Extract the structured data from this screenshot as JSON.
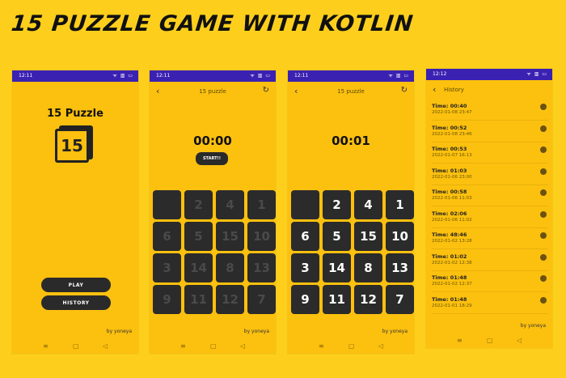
{
  "banner": "15 PUZZLE GAME WITH KOTLIN",
  "screens": {
    "home": {
      "status_time": "12:11",
      "status_icons": "ᯤ ▥ ▭",
      "app_title": "15 Puzzle",
      "logo_text": "15",
      "play": "PLAY",
      "history": "HISTORY",
      "author": "by yoneya"
    },
    "game_start": {
      "status_time": "12:11",
      "status_icons": "ᯤ ▥ ▭",
      "title": "15 puzzle",
      "timer": "00:00",
      "start": "START!!",
      "tiles": [
        "",
        "2",
        "4",
        "1",
        "6",
        "5",
        "15",
        "10",
        "3",
        "14",
        "8",
        "13",
        "9",
        "11",
        "12",
        "7"
      ],
      "dimmed": true,
      "author": "by yoneya"
    },
    "game_play": {
      "status_time": "12:11",
      "status_icons": "ᯤ ▥ ▭",
      "title": "15 puzzle",
      "timer": "00:01",
      "tiles": [
        "",
        "2",
        "4",
        "1",
        "6",
        "5",
        "15",
        "10",
        "3",
        "14",
        "8",
        "13",
        "9",
        "11",
        "12",
        "7"
      ],
      "dimmed": false,
      "author": "by yoneya"
    },
    "history": {
      "status_time": "12:12",
      "status_icons": "ᯤ ▥ ▭",
      "title": "History",
      "author": "by yoneya",
      "entries": [
        {
          "time": "Time: 00:40",
          "date": "2022-01-08 23:47"
        },
        {
          "time": "Time: 00:52",
          "date": "2022-01-08 23:46"
        },
        {
          "time": "Time: 00:53",
          "date": "2022-01-07 16:13"
        },
        {
          "time": "Time: 01:03",
          "date": "2022-01-06 23:00"
        },
        {
          "time": "Time: 00:58",
          "date": "2022-01-06 11:03"
        },
        {
          "time": "Time: 02:06",
          "date": "2022-01-06 11:02"
        },
        {
          "time": "Time: 48:46",
          "date": "2022-01-02 13:28"
        },
        {
          "time": "Time: 01:02",
          "date": "2022-01-02 12:38"
        },
        {
          "time": "Time: 01:48",
          "date": "2022-01-02 12:37"
        },
        {
          "time": "Time: 01:48",
          "date": "2022-01-01 18:29"
        }
      ]
    }
  },
  "nav_icons": {
    "menu": "≡",
    "home": "▢",
    "back": "◁"
  }
}
